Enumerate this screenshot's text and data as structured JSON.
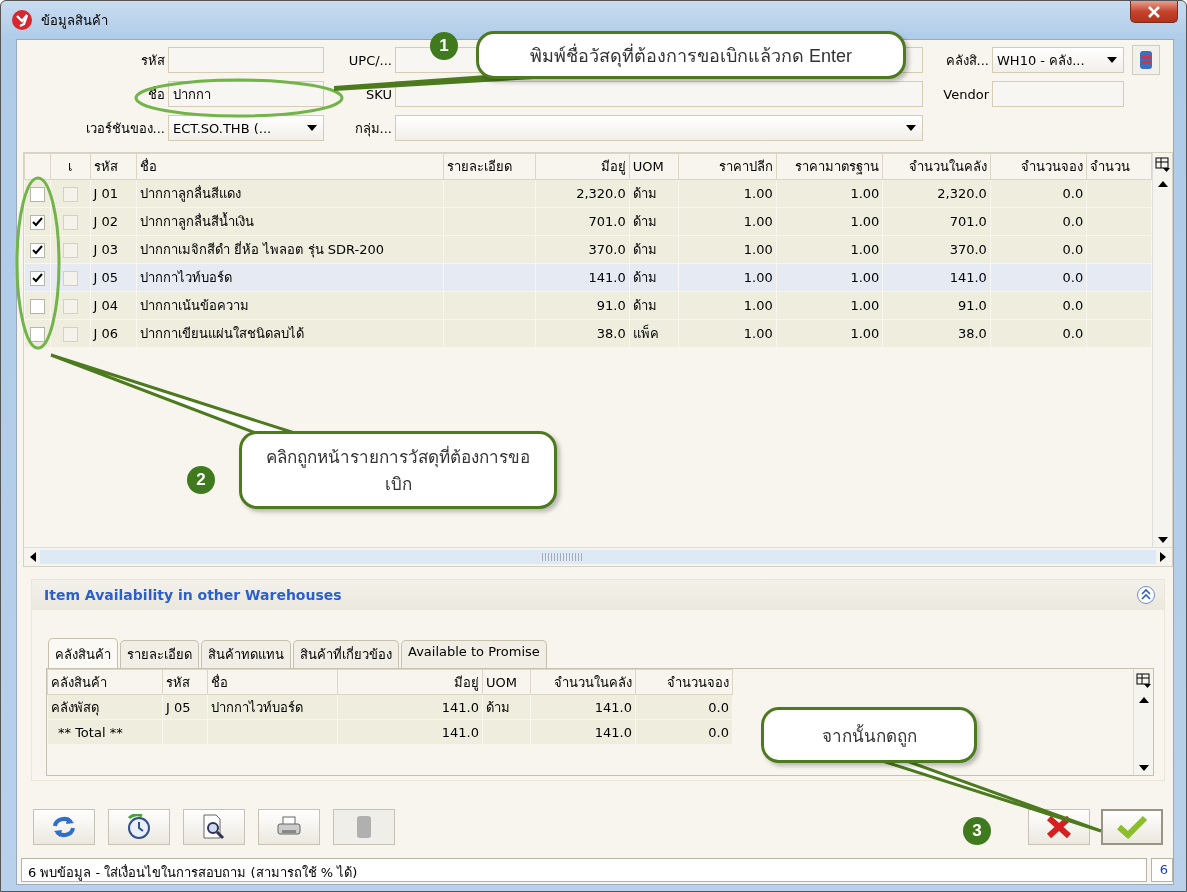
{
  "window": {
    "title": "ข้อมูลสินค้า"
  },
  "form": {
    "rows": [
      [
        {
          "label": "รหัส",
          "kind": "text"
        },
        {
          "label": "UPC/...",
          "kind": "text"
        },
        {
          "label": "คลังสิ...",
          "kind": "dropdown",
          "value": "WH10 - คลัง..."
        }
      ],
      [
        {
          "label": "ชื่อ",
          "kind": "text",
          "value": "ปากกา"
        },
        {
          "label": "SKU",
          "kind": "text"
        },
        {
          "label": "Vendor",
          "kind": "text"
        }
      ],
      [
        {
          "label": "เวอร์ชันของ...",
          "kind": "dropdown",
          "value": "ECT.SO.THB (..."
        },
        {
          "label": "กลุ่ม...",
          "kind": "dropdown"
        }
      ]
    ]
  },
  "table": {
    "columns": [
      {
        "label": "เ"
      },
      {
        "label": "รหัส"
      },
      {
        "label": "ชื่อ"
      },
      {
        "label": "รายละเอียด"
      },
      {
        "label": "มีอยู่"
      },
      {
        "label": "UOM"
      },
      {
        "label": "ราคาปลีก"
      },
      {
        "label": "ราคามาตรฐาน"
      },
      {
        "label": "จำนวนในคลัง"
      },
      {
        "label": "จำนวนจอง"
      },
      {
        "label": "จำนวน"
      }
    ],
    "rows": [
      {
        "checked": false,
        "marked": false,
        "selected": false,
        "code": "J 01",
        "name": "ปากกาลูกลื่นสีแดง",
        "on_hand": "2,320.0",
        "uom": "ด้าม",
        "retail": "1.00",
        "standard": "1.00",
        "in_stock": "2,320.0",
        "reserved": "0.0"
      },
      {
        "checked": true,
        "marked": false,
        "selected": false,
        "code": "J 02",
        "name": "ปากกาลูกลื่นสีน้ำเงิน",
        "on_hand": "701.0",
        "uom": "ด้าม",
        "retail": "1.00",
        "standard": "1.00",
        "in_stock": "701.0",
        "reserved": "0.0"
      },
      {
        "checked": true,
        "marked": false,
        "selected": false,
        "code": "J 03",
        "name": "ปากกาเมจิกสีดำ ยี่ห้อ ไพลอต รุ่น SDR-200",
        "on_hand": "370.0",
        "uom": "ด้าม",
        "retail": "1.00",
        "standard": "1.00",
        "in_stock": "370.0",
        "reserved": "0.0"
      },
      {
        "checked": true,
        "marked": false,
        "selected": true,
        "code": "J 05",
        "name": "ปากกาไวท์บอร์ด",
        "on_hand": "141.0",
        "uom": "ด้าม",
        "retail": "1.00",
        "standard": "1.00",
        "in_stock": "141.0",
        "reserved": "0.0"
      },
      {
        "checked": false,
        "marked": false,
        "selected": false,
        "code": "J 04",
        "name": "ปากกาเน้นข้อความ",
        "on_hand": "91.0",
        "uom": "ด้าม",
        "retail": "1.00",
        "standard": "1.00",
        "in_stock": "91.0",
        "reserved": "0.0"
      },
      {
        "checked": false,
        "marked": false,
        "selected": false,
        "code": "J 06",
        "name": "ปากกาเขียนแผ่นใสชนิดลบได้",
        "on_hand": "38.0",
        "uom": "แพ็ค",
        "retail": "1.00",
        "standard": "1.00",
        "in_stock": "38.0",
        "reserved": "0.0"
      }
    ]
  },
  "panel": {
    "title": "Item Availability in other Warehouses",
    "expanded": true,
    "tabs": [
      {
        "label": "คลังสินค้า",
        "selected": true
      },
      {
        "label": "รายละเอียด",
        "selected": false
      },
      {
        "label": "สินค้าทดแทน",
        "selected": false
      },
      {
        "label": "สินค้าที่เกี่ยวข้อง",
        "selected": false
      },
      {
        "label": "Available to Promise",
        "selected": false
      }
    ],
    "columns": [
      {
        "label": "คลังสินค้า"
      },
      {
        "label": "รหัส"
      },
      {
        "label": "ชื่อ"
      },
      {
        "label": "มีอยู่"
      },
      {
        "label": "UOM"
      },
      {
        "label": "จำนวนในคลัง"
      },
      {
        "label": "จำนวนจอง"
      }
    ],
    "rows": [
      {
        "kind": "item",
        "warehouse": "คลังพัสดุ",
        "code": "J 05",
        "name": "ปากกาไวท์บอร์ด",
        "on_hand": "141.0",
        "uom": "ด้าม",
        "in_stock": "141.0",
        "reserved": "0.0"
      },
      {
        "kind": "total",
        "warehouse": "** Total **",
        "on_hand": "141.0",
        "in_stock": "141.0",
        "reserved": "0.0"
      }
    ]
  },
  "toolbar": [
    {
      "kind": "refresh",
      "disabled": false
    },
    {
      "kind": "history",
      "disabled": false
    },
    {
      "kind": "preview",
      "disabled": false
    },
    {
      "kind": "print",
      "disabled": false
    },
    {
      "kind": "blank",
      "disabled": true
    }
  ],
  "actions": [
    {
      "kind": "cancel"
    },
    {
      "kind": "ok"
    }
  ],
  "status_bar": {
    "text": "6 พบข้อมูล - ใส่เงื่อนไขในการสอบถาม (สามารถใช้ % ได้)",
    "count": "6"
  },
  "annotations": [
    {
      "number": "1",
      "text": "พิมพ์ชื่อวัสดุที่ต้องการขอเบิกแล้วกด Enter"
    },
    {
      "number": "2",
      "text": "คลิกถูกหน้ารายการวัสดุที่ต้องการขอเบิก"
    },
    {
      "number": "3",
      "text": "จากนั้นกดถูก"
    }
  ]
}
